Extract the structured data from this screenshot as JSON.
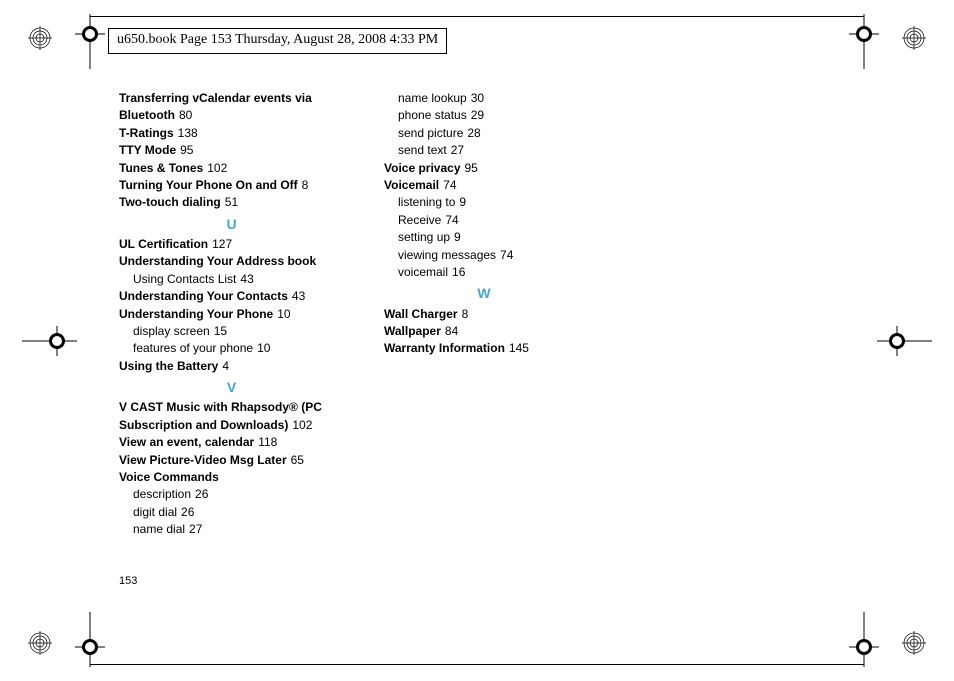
{
  "header_text": "u650.book  Page 153  Thursday, August 28, 2008  4:33 PM",
  "footer_page": "153",
  "letters": {
    "U": "U",
    "V": "V",
    "W": "W"
  },
  "col1": {
    "transferring_vcalendar": "Transferring vCalendar events via Bluetooth",
    "transferring_vcalendar_p": "80",
    "tratings": "T-Ratings",
    "tratings_p": "138",
    "tty": "TTY Mode",
    "tty_p": "95",
    "tunes": "Tunes & Tones",
    "tunes_p": "102",
    "turning": "Turning Your Phone On and Off",
    "turning_p": "8",
    "twotouch": "Two-touch dialing",
    "twotouch_p": "51",
    "ul": "UL Certification",
    "ul_p": "127",
    "addrbook": "Understanding Your Address book",
    "addrbook_sub1": "Using Contacts List",
    "addrbook_sub1_p": "43",
    "ucontacts": "Understanding Your Contacts",
    "ucontacts_p": "43",
    "uphone": "Understanding Your Phone",
    "uphone_p": "10",
    "uphone_sub1": "display screen",
    "uphone_sub1_p": "15",
    "uphone_sub2": "features of your phone",
    "uphone_sub2_p": "10",
    "battery": "Using the Battery",
    "battery_p": "4",
    "vcast": "V CAST Music with Rhapsody® (PC Subscription and Downloads)",
    "vcast_p": "102",
    "viewevent": "View an event, calendar",
    "viewevent_p": "118",
    "viewpic": "View Picture-Video Msg Later",
    "viewpic_p": "65",
    "voicecmd": "Voice Commands",
    "voicecmd_sub1": "description",
    "voicecmd_sub1_p": "26",
    "voicecmd_sub2": "digit dial",
    "voicecmd_sub2_p": "26",
    "voicecmd_sub3": "name dial",
    "voicecmd_sub3_p": "27"
  },
  "col2": {
    "vc_sub4": "name lookup",
    "vc_sub4_p": "30",
    "vc_sub5": "phone status",
    "vc_sub5_p": "29",
    "vc_sub6": "send picture",
    "vc_sub6_p": "28",
    "vc_sub7": "send text",
    "vc_sub7_p": "27",
    "voicepriv": "Voice privacy",
    "voicepriv_p": "95",
    "voicemail": "Voicemail",
    "voicemail_p": "74",
    "vm_sub1": "listening to",
    "vm_sub1_p": "9",
    "vm_sub2": "Receive",
    "vm_sub2_p": "74",
    "vm_sub3": "setting up",
    "vm_sub3_p": "9",
    "vm_sub4": "viewing messages",
    "vm_sub4_p": "74",
    "vm_sub5": "voicemail",
    "vm_sub5_p": "16",
    "wall": "Wall Charger",
    "wall_p": "8",
    "wallpaper": "Wallpaper",
    "wallpaper_p": "84",
    "warranty": "Warranty Information",
    "warranty_p": "145"
  }
}
